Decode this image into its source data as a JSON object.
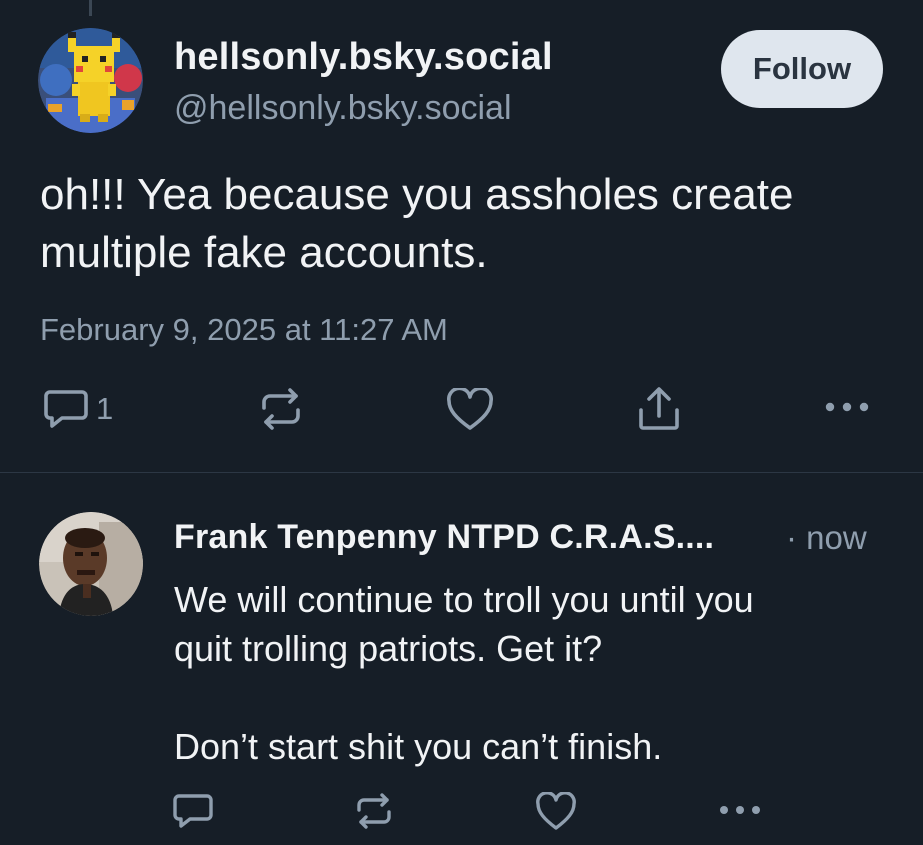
{
  "main_post": {
    "display_name": "hellsonly.bsky.social",
    "handle": "@hellsonly.bsky.social",
    "follow_label": "Follow",
    "text_lines": [
      "oh!!! Yea because you assholes create",
      "multiple fake accounts."
    ],
    "timestamp": "February 9, 2025 at 11:27 AM",
    "reply_count": "1",
    "avatar_icon": "pikachu-avatar",
    "actions": [
      "reply-icon",
      "repost-icon",
      "like-icon",
      "share-icon",
      "more-icon"
    ]
  },
  "reply_post": {
    "display_name": "Frank Tenpenny NTPD C.R.A.S....",
    "time": "· now",
    "text_lines": [
      "We will continue to troll you until you",
      "quit trolling patriots. Get it?",
      "",
      "Don’t start shit you can’t finish."
    ],
    "avatar_icon": "person-avatar",
    "actions": [
      "reply-icon",
      "repost-icon",
      "like-icon",
      "more-icon"
    ]
  },
  "colors": {
    "background": "#161e27",
    "primary_text": "#f1f3f5",
    "secondary_text": "#8f9eae",
    "follow_button_bg": "#dfe6ee",
    "follow_button_text": "#2a3440",
    "divider": "#2c3744"
  }
}
